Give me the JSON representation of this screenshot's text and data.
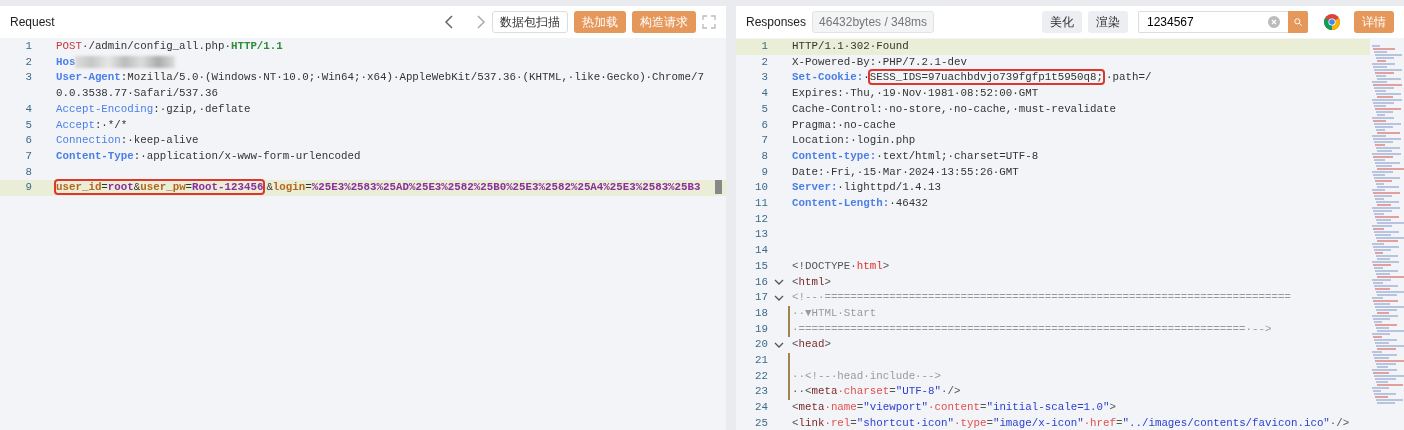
{
  "request": {
    "title": "Request",
    "toolbar": [
      {
        "kind": "outline",
        "label": "数据包扫描"
      },
      {
        "kind": "accent",
        "label": "热加载"
      },
      {
        "kind": "accent",
        "label": "构造请求"
      }
    ],
    "lines": [
      {
        "number": "1",
        "highlighted": false,
        "tokens": [
          {
            "kind": "method",
            "text": "POST"
          },
          {
            "kind": "plain",
            "text": "·/admin/config_all.php·"
          },
          {
            "kind": "version",
            "text": "HTTP/1.1"
          }
        ]
      },
      {
        "number": "2",
        "highlighted": false,
        "tokens": [
          {
            "kind": "key-bold",
            "text": "Hos"
          },
          {
            "kind": "redacted"
          }
        ]
      },
      {
        "number": "3",
        "highlighted": false,
        "tokens": [
          {
            "kind": "key-bold",
            "text": "User-Agent"
          },
          {
            "kind": "plain",
            "text": ":Mozilla/5.0·(Windows·NT·10.0;·Win64;·x64)·AppleWebKit/537.36·(KHTML,·like·Gecko)·Chrome/70.0.3538.77·Safari/537.36"
          }
        ]
      },
      {
        "number": "4",
        "highlighted": false,
        "tokens": [
          {
            "kind": "key",
            "text": "Accept-Encoding"
          },
          {
            "kind": "plain",
            "text": ":·gzip,·deflate"
          }
        ]
      },
      {
        "number": "5",
        "highlighted": false,
        "tokens": [
          {
            "kind": "key",
            "text": "Accept"
          },
          {
            "kind": "plain",
            "text": ":·*/*"
          }
        ]
      },
      {
        "number": "6",
        "highlighted": false,
        "tokens": [
          {
            "kind": "key",
            "text": "Connection"
          },
          {
            "kind": "plain",
            "text": ":·keep-alive"
          }
        ]
      },
      {
        "number": "7",
        "highlighted": false,
        "tokens": [
          {
            "kind": "key-bold",
            "text": "Content-Type"
          },
          {
            "kind": "plain",
            "text": ":·application/x-www-form-urlencoded"
          }
        ]
      },
      {
        "number": "8",
        "highlighted": false
      },
      {
        "number": "9",
        "highlighted": true,
        "segments": [
          {
            "boxed": true,
            "tokens": [
              {
                "kind": "param",
                "text": "user_id"
              },
              {
                "kind": "op",
                "text": "="
              },
              {
                "kind": "param-value",
                "text": "root"
              },
              {
                "kind": "op",
                "text": "&"
              },
              {
                "kind": "param",
                "text": "user_pw"
              },
              {
                "kind": "op",
                "text": "="
              },
              {
                "kind": "param-value",
                "text": "Root-123456"
              }
            ]
          },
          {
            "boxed": false,
            "tokens": [
              {
                "kind": "op",
                "text": "&"
              },
              {
                "kind": "param",
                "text": "login"
              },
              {
                "kind": "op",
                "text": "="
              },
              {
                "kind": "param-value",
                "text": "%25E3%2583%25AD%25E3%2582%25B0%25E3%2582%25A4%25E3%2583%25B3"
              }
            ]
          }
        ]
      }
    ]
  },
  "response": {
    "title": "Responses",
    "stats": "46432bytes / 348ms",
    "toolbar": [
      {
        "kind": "grey",
        "label": "美化"
      },
      {
        "kind": "grey",
        "label": "渲染"
      }
    ],
    "search": {
      "value": "1234567"
    },
    "detail_button": "详情",
    "lines": [
      {
        "number": "1",
        "highlighted": true,
        "fold": false,
        "guide": false,
        "tokens": [
          {
            "kind": "plain",
            "text": "HTTP/1.1·302·Found"
          }
        ]
      },
      {
        "number": "2",
        "highlighted": false,
        "fold": false,
        "guide": false,
        "tokens": [
          {
            "kind": "plain",
            "text": "X-Powered-By:·PHP/7.2.1-dev"
          }
        ]
      },
      {
        "number": "3",
        "highlighted": false,
        "fold": false,
        "guide": false,
        "segments": [
          {
            "boxed": false,
            "tokens": [
              {
                "kind": "key-bold",
                "text": "Set-Cookie:"
              },
              {
                "kind": "plain",
                "text": "·"
              }
            ]
          },
          {
            "boxed": true,
            "tokens": [
              {
                "kind": "plain",
                "text": "SESS_IDS=97uachbdvjo739fgfp1t5950q8;"
              }
            ]
          },
          {
            "boxed": false,
            "tokens": [
              {
                "kind": "plain",
                "text": "·path=/"
              }
            ]
          }
        ]
      },
      {
        "number": "4",
        "highlighted": false,
        "fold": false,
        "guide": false,
        "tokens": [
          {
            "kind": "plain",
            "text": "Expires:·Thu,·19·Nov·1981·08:52:00·GMT"
          }
        ]
      },
      {
        "number": "5",
        "highlighted": false,
        "fold": false,
        "guide": false,
        "tokens": [
          {
            "kind": "plain",
            "text": "Cache-Control:·no-store,·no-cache,·must-revalidate"
          }
        ]
      },
      {
        "number": "6",
        "highlighted": false,
        "fold": false,
        "guide": false,
        "tokens": [
          {
            "kind": "plain",
            "text": "Pragma:·no-cache"
          }
        ]
      },
      {
        "number": "7",
        "highlighted": false,
        "fold": false,
        "guide": false,
        "tokens": [
          {
            "kind": "plain",
            "text": "Location:·login.php"
          }
        ]
      },
      {
        "number": "8",
        "highlighted": false,
        "fold": false,
        "guide": false,
        "tokens": [
          {
            "kind": "key-bold",
            "text": "Content-type:"
          },
          {
            "kind": "plain",
            "text": "·text/html;·charset=UTF-8"
          }
        ]
      },
      {
        "number": "9",
        "highlighted": false,
        "fold": false,
        "guide": false,
        "tokens": [
          {
            "kind": "plain",
            "text": "Date:·Fri,·15·Mar·2024·13:55:26·GMT"
          }
        ]
      },
      {
        "number": "10",
        "highlighted": false,
        "fold": false,
        "guide": false,
        "tokens": [
          {
            "kind": "key-bold",
            "text": "Server:"
          },
          {
            "kind": "plain",
            "text": "·lighttpd/1.4.13"
          }
        ]
      },
      {
        "number": "11",
        "highlighted": false,
        "fold": false,
        "guide": false,
        "tokens": [
          {
            "kind": "key-bold",
            "text": "Content-Length:"
          },
          {
            "kind": "plain",
            "text": "·46432"
          }
        ]
      },
      {
        "number": "12",
        "highlighted": false,
        "fold": false,
        "guide": false
      },
      {
        "number": "13",
        "highlighted": false,
        "fold": false,
        "guide": false
      },
      {
        "number": "14",
        "highlighted": false,
        "fold": false,
        "guide": false
      },
      {
        "number": "15",
        "highlighted": false,
        "fold": false,
        "guide": false,
        "tokens": [
          {
            "kind": "bracket",
            "text": "<!DOCTYPE·"
          },
          {
            "kind": "doctype",
            "text": "html"
          },
          {
            "kind": "bracket",
            "text": ">"
          }
        ]
      },
      {
        "number": "16",
        "highlighted": false,
        "fold": true,
        "guide": false,
        "tokens": [
          {
            "kind": "bracket",
            "text": "<"
          },
          {
            "kind": "tag",
            "text": "html"
          },
          {
            "kind": "bracket",
            "text": ">"
          }
        ]
      },
      {
        "number": "17",
        "highlighted": false,
        "fold": true,
        "guide": false,
        "tokens": [
          {
            "kind": "comment",
            "text": "<!--·========================================================================"
          }
        ]
      },
      {
        "number": "18",
        "highlighted": false,
        "fold": false,
        "guide": true,
        "tokens": [
          {
            "kind": "comment",
            "text": "··▼HTML·Start"
          }
        ]
      },
      {
        "number": "19",
        "highlighted": false,
        "fold": false,
        "guide": true,
        "tokens": [
          {
            "kind": "comment",
            "text": "·=====================================================================·-->"
          }
        ]
      },
      {
        "number": "20",
        "highlighted": false,
        "fold": true,
        "guide": false,
        "tokens": [
          {
            "kind": "bracket",
            "text": "<"
          },
          {
            "kind": "tag",
            "text": "head"
          },
          {
            "kind": "bracket",
            "text": ">"
          }
        ]
      },
      {
        "number": "21",
        "highlighted": false,
        "fold": false,
        "guide": true
      },
      {
        "number": "22",
        "highlighted": false,
        "fold": false,
        "guide": true,
        "tokens": [
          {
            "kind": "comment",
            "text": "··<!--·head·include·-->"
          }
        ]
      },
      {
        "number": "23",
        "highlighted": false,
        "fold": false,
        "guide": true,
        "tokens": [
          {
            "kind": "bracket",
            "text": "··<"
          },
          {
            "kind": "tag",
            "text": "meta"
          },
          {
            "kind": "attr",
            "text": "·charset"
          },
          {
            "kind": "bracket",
            "text": "="
          },
          {
            "kind": "string",
            "text": "\"UTF-8\""
          },
          {
            "kind": "bracket",
            "text": "·/>"
          }
        ]
      },
      {
        "number": "24",
        "highlighted": false,
        "fold": false,
        "guide": false,
        "tokens": [
          {
            "kind": "bracket",
            "text": "<"
          },
          {
            "kind": "tag",
            "text": "meta"
          },
          {
            "kind": "attr",
            "text": "·name"
          },
          {
            "kind": "bracket",
            "text": "="
          },
          {
            "kind": "string",
            "text": "\"viewport\""
          },
          {
            "kind": "attr",
            "text": "·content"
          },
          {
            "kind": "bracket",
            "text": "="
          },
          {
            "kind": "string",
            "text": "\"initial-scale=1.0\""
          },
          {
            "kind": "bracket",
            "text": ">"
          }
        ]
      },
      {
        "number": "25",
        "highlighted": false,
        "fold": false,
        "guide": false,
        "tokens": [
          {
            "kind": "bracket",
            "text": "<"
          },
          {
            "kind": "tag",
            "text": "link"
          },
          {
            "kind": "attr",
            "text": "·rel"
          },
          {
            "kind": "bracket",
            "text": "="
          },
          {
            "kind": "string",
            "text": "\"shortcut·icon\""
          },
          {
            "kind": "attr",
            "text": "·type"
          },
          {
            "kind": "bracket",
            "text": "="
          },
          {
            "kind": "string",
            "text": "\"image/x-icon\""
          },
          {
            "kind": "attr",
            "text": "·href"
          },
          {
            "kind": "bracket",
            "text": "="
          },
          {
            "kind": "string",
            "text": "\"../images/contents/favicon.ico\""
          },
          {
            "kind": "bracket",
            "text": "·/>"
          }
        ]
      }
    ]
  }
}
